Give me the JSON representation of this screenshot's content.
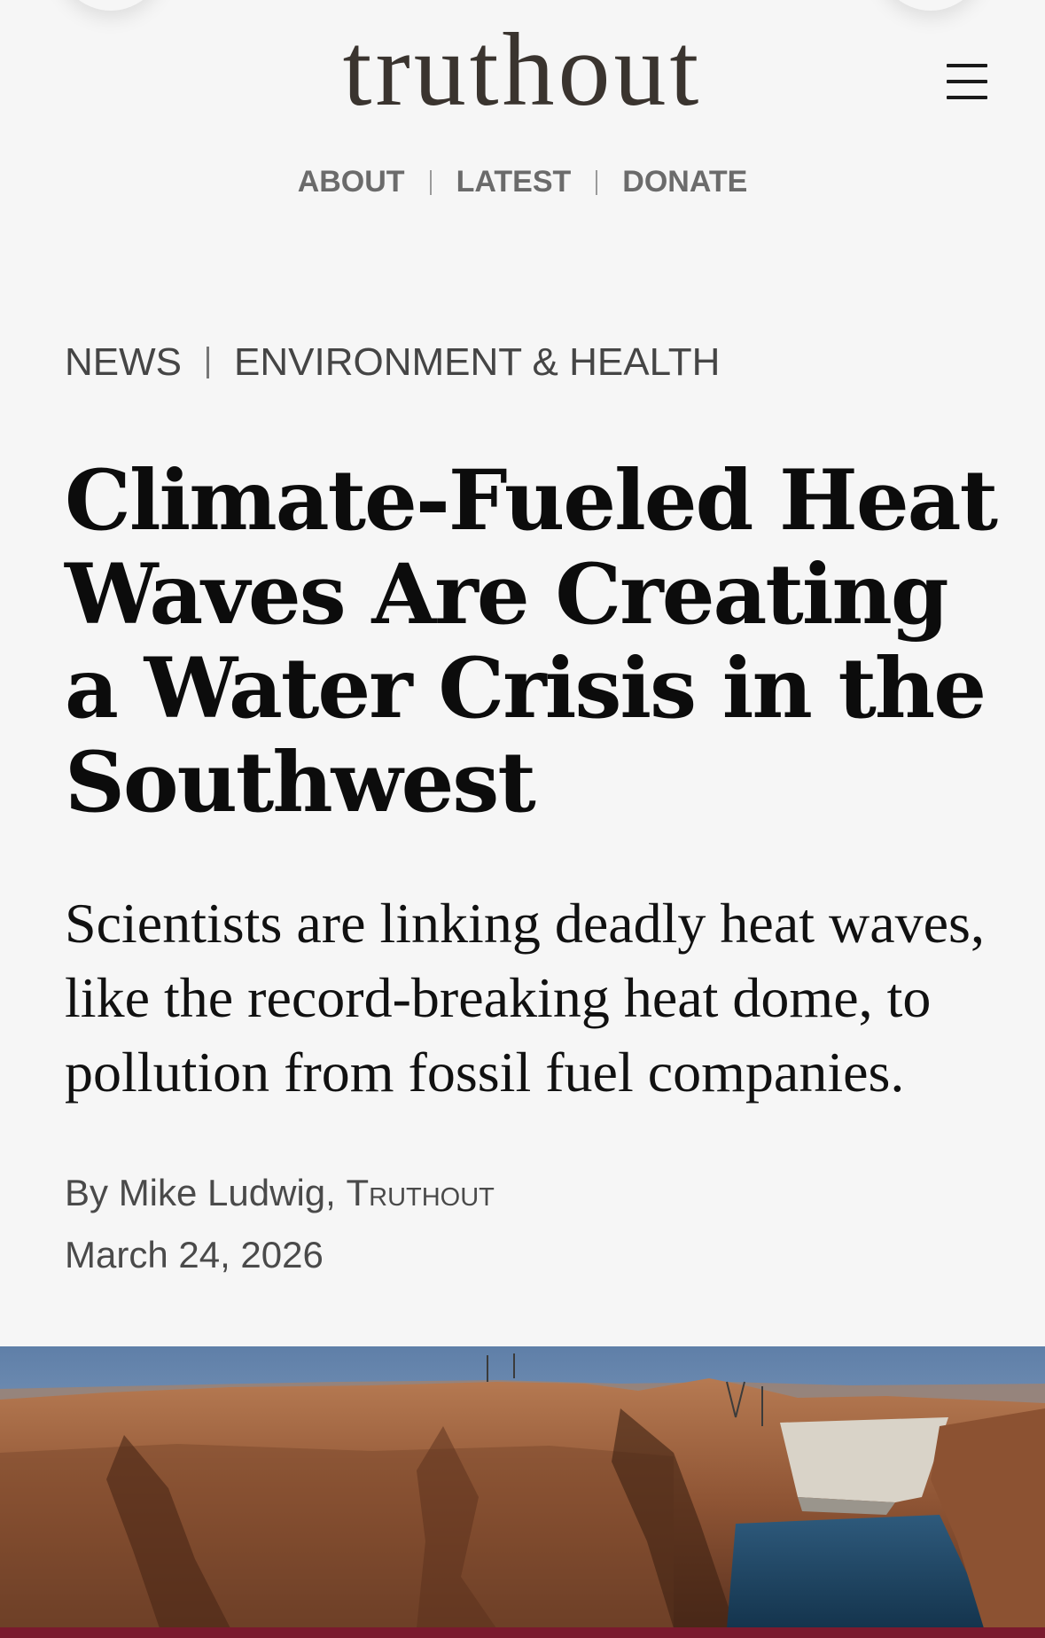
{
  "header": {
    "logo_text": "truthout",
    "menu_icon": "hamburger-icon",
    "nav": [
      {
        "label": "ABOUT"
      },
      {
        "label": "LATEST"
      },
      {
        "label": "DONATE"
      }
    ]
  },
  "article": {
    "section": "NEWS",
    "category": "ENVIRONMENT & HEALTH",
    "title": "Climate-Fueled Heat Waves Are Creating a Water Crisis in the Southwest",
    "dek": "Scientists are linking deadly heat waves, like the record-breaking heat dome, to pollution from fossil fuel companies.",
    "byline_prefix": "By",
    "author": "Mike Ludwig",
    "publication": "Truthout",
    "date": "March 24, 2026"
  },
  "colors": {
    "background": "#f6f6f6",
    "accent_bar": "#7a1a2e",
    "nav_text": "#6b6b6b",
    "headline": "#0c0c0c"
  }
}
